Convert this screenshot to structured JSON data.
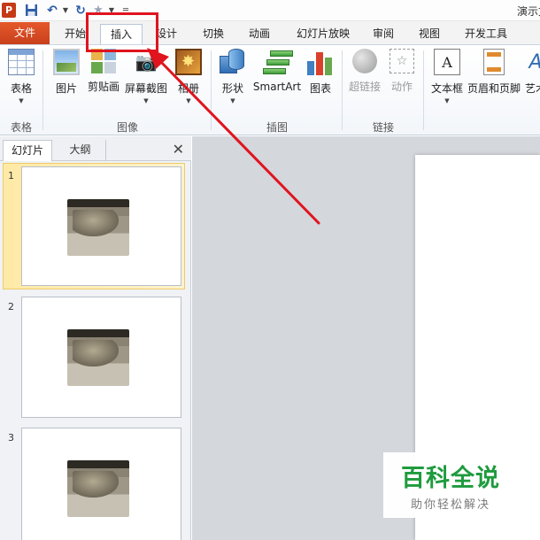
{
  "window": {
    "title": "演示文"
  },
  "quick_access": {
    "app_logo": "P"
  },
  "tabs": [
    "文件",
    "开始",
    "插入",
    "设计",
    "切换",
    "动画",
    "幻灯片放映",
    "审阅",
    "视图",
    "开发工具"
  ],
  "ribbon": {
    "table": "表格",
    "picture": "图片",
    "clipart": "剪贴画",
    "screenshot": "屏幕截图",
    "album": "相册",
    "shapes": "形状",
    "smartart": "SmartArt",
    "chart": "图表",
    "hyperlink": "超链接",
    "action": "动作",
    "textbox": "文本框",
    "header_footer": "页眉和页脚",
    "wordart": "艺术",
    "groups": [
      "表格",
      "图像",
      "插图",
      "链接"
    ]
  },
  "slides_pane": {
    "tabs": [
      "幻灯片",
      "大纲"
    ],
    "slides": [
      "1",
      "2",
      "3"
    ]
  },
  "watermark": {
    "main": "百科全说",
    "sub": "助你轻松解决"
  },
  "colors": {
    "file_tab": "#d9512c",
    "highlight": "#e0141e",
    "watermark": "#1e9b3e"
  }
}
